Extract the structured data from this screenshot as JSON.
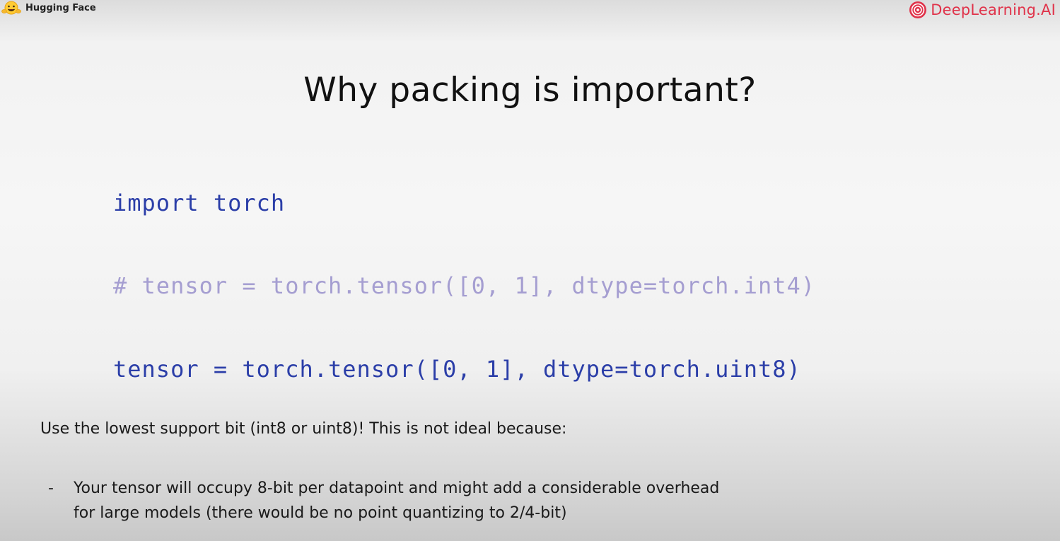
{
  "header": {
    "left_brand": "Hugging Face",
    "left_icon": "hugging-face-emoji-icon",
    "right_brand": "DeepLearning.AI",
    "right_icon": "deeplearning-ai-logo-icon",
    "right_brand_color": "#e0334a"
  },
  "slide": {
    "title": "Why packing is important?",
    "code": {
      "import_line": "import torch",
      "comment_line": "# tensor = torch.tensor([0, 1], dtype=torch.int4)",
      "assign_line": "tensor = torch.tensor([0, 1], dtype=torch.uint8)",
      "code_color": "#2b3ea8",
      "comment_color": "#a59ed1"
    },
    "body_text": "Use the lowest support bit (int8 or uint8)! This is not ideal because:",
    "bullets": [
      {
        "marker": "-",
        "line1": "Your tensor will occupy 8-bit per datapoint and might add a considerable overhead",
        "line2": "for large models (there would be no point quantizing to 2/4-bit)"
      }
    ]
  }
}
